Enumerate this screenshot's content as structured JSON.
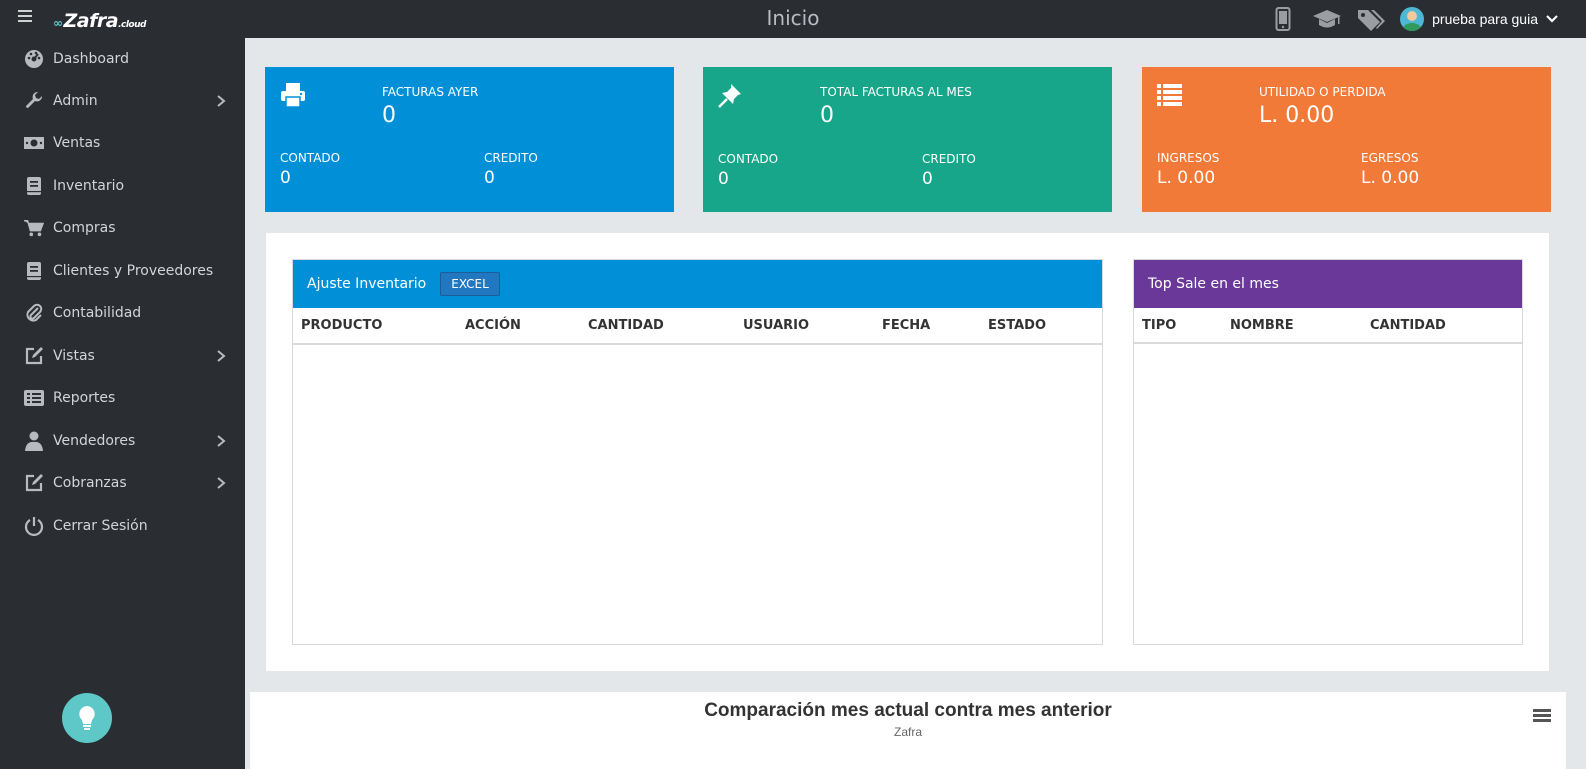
{
  "header": {
    "logo_text": "Zafra",
    "logo_suffix": ".cloud",
    "title": "Inicio",
    "user_name": "prueba para guia"
  },
  "sidebar": {
    "items": [
      {
        "label": "Dashboard",
        "icon": "dashboard-icon"
      },
      {
        "label": "Admin",
        "icon": "wrench-icon",
        "submenu": true
      },
      {
        "label": "Ventas",
        "icon": "money-icon"
      },
      {
        "label": "Inventario",
        "icon": "book-icon"
      },
      {
        "label": "Compras",
        "icon": "cart-icon"
      },
      {
        "label": "Clientes y Proveedores",
        "icon": "book-icon"
      },
      {
        "label": "Contabilidad",
        "icon": "paperclip-icon"
      },
      {
        "label": "Vistas",
        "icon": "edit-icon",
        "submenu": true
      },
      {
        "label": "Reportes",
        "icon": "list-icon"
      },
      {
        "label": "Vendedores",
        "icon": "user-icon",
        "submenu": true
      },
      {
        "label": "Cobranzas",
        "icon": "edit-icon",
        "submenu": true
      },
      {
        "label": "Cerrar Sesión",
        "icon": "power-icon"
      }
    ]
  },
  "cards": [
    {
      "title": "FACTURAS AYER",
      "value": "0",
      "left_label": "CONTADO",
      "left_value": "0",
      "right_label": "CREDITO",
      "right_value": "0",
      "color": "#0190d8",
      "icon": "print-icon"
    },
    {
      "title": "TOTAL FACTURAS AL MES",
      "value": "0",
      "left_label": "CONTADO",
      "left_value": "0",
      "right_label": "CREDITO",
      "right_value": "0",
      "color": "#17a689",
      "icon": "pin-icon"
    },
    {
      "title": "UTILIDAD O PERDIDA",
      "value": "L. 0.00",
      "left_label": "INGRESOS",
      "left_value": "L. 0.00",
      "right_label": "EGRESOS",
      "right_value": "L. 0.00",
      "color": "#f27a38",
      "icon": "list-icon"
    }
  ],
  "ajuste": {
    "title": "Ajuste Inventario",
    "excel_label": "EXCEL",
    "header_color": "#0190d8",
    "columns": [
      "PRODUCTO",
      "ACCIÓN",
      "CANTIDAD",
      "USUARIO",
      "FECHA",
      "ESTADO"
    ]
  },
  "topsale": {
    "title": "Top Sale en el mes",
    "header_color": "#6a3898",
    "columns": [
      "TIPO",
      "NOMBRE",
      "CANTIDAD"
    ]
  },
  "chart": {
    "title": "Comparación mes actual contra mes anterior",
    "subtitle": "Zafra"
  }
}
